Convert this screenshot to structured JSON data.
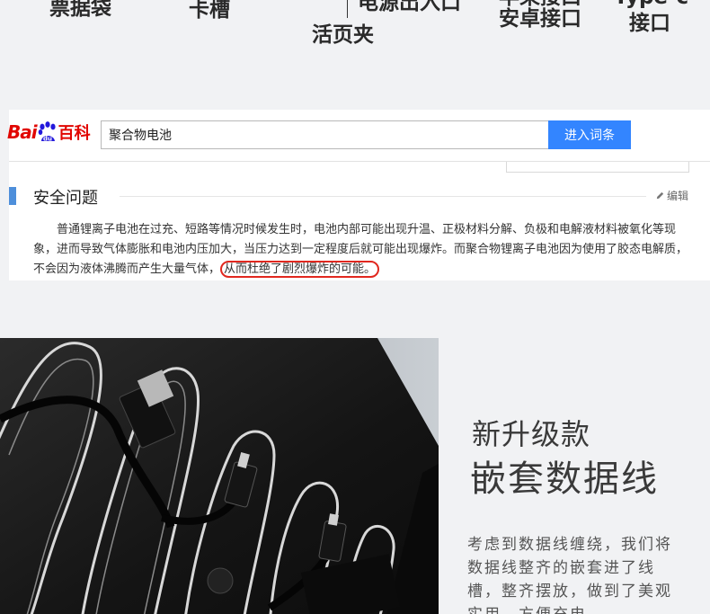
{
  "top_labels": {
    "ticket_bag": "票据袋",
    "card_slot": "卡槽",
    "power_io": "电源出入口",
    "loose_leaf": "活页夹",
    "apple_line1": "苹果接口",
    "apple_line2": "安卓接口",
    "typec_line1": "Type-c",
    "typec_line2": "接口"
  },
  "baidu": {
    "logo_left": "Bai",
    "logo_du": "du",
    "logo_right": "百科",
    "search_value": "聚合物电池",
    "search_button": "进入词条",
    "section_title": "安全问题",
    "edit_label": "编辑",
    "paragraph_main": "普通锂离子电池在过充、短路等情况时候发生时，电池内部可能出现升温、正极材料分解、负极和电解液材料被氧化等现象，进而导致气体膨胀和电池内压加大，当压力达到一定程度后就可能出现爆炸。而聚合物锂离子电池因为使用了胶态电解质，不会因为液体沸腾而产生大量气体，",
    "paragraph_highlight": "从而杜绝了剧烈爆炸的可能。"
  },
  "product": {
    "subtitle": "新升级款",
    "title": "嵌套数据线",
    "description": "考虑到数据线缠绕，我们将数据线整齐的嵌套进了线槽，整齐摆放，做到了美观实用，方便充电。"
  },
  "colors": {
    "baidu_red": "#e10601",
    "baidu_blue": "#3385ff",
    "section_bar": "#4e8fdb",
    "highlight_ring": "#e1281f"
  }
}
